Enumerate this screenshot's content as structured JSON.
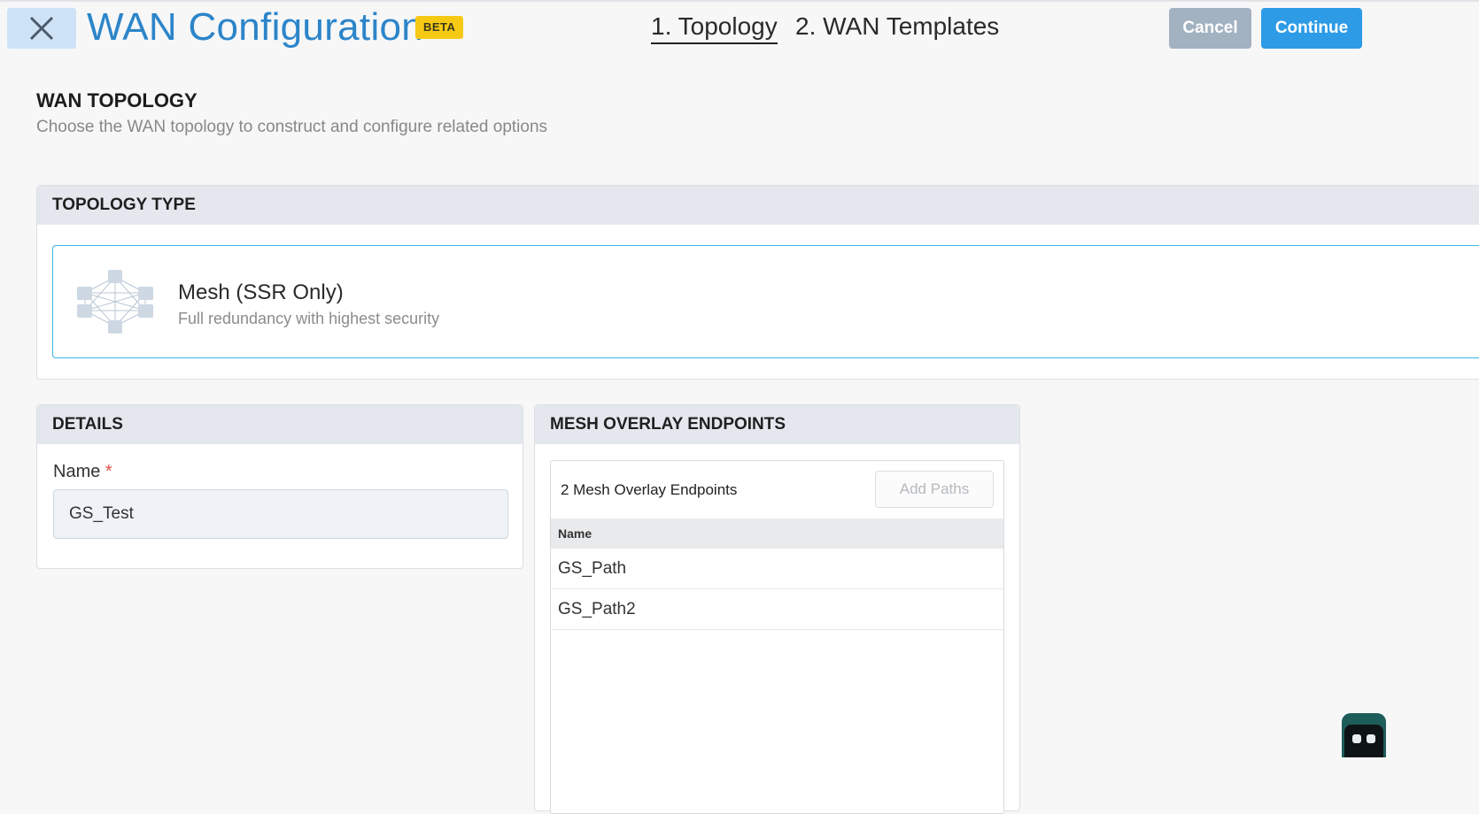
{
  "header": {
    "title": "WAN Configuration",
    "badge": "BETA",
    "steps": [
      {
        "label": "1. Topology",
        "active": true
      },
      {
        "label": "2. WAN Templates",
        "active": false
      }
    ],
    "cancel_label": "Cancel",
    "continue_label": "Continue"
  },
  "section": {
    "title": "WAN TOPOLOGY",
    "subtitle": "Choose the WAN topology to construct and configure related options"
  },
  "topology": {
    "header": "TOPOLOGY TYPE",
    "option": {
      "icon": "mesh-network-icon",
      "title": "Mesh (SSR Only)",
      "subtitle": "Full redundancy with highest security",
      "selected": true
    }
  },
  "details": {
    "header": "DETAILS",
    "name_label": "Name",
    "required_marker": "*",
    "name_value": "GS_Test"
  },
  "mesh": {
    "header": "MESH OVERLAY ENDPOINTS",
    "count_label": "2 Mesh Overlay Endpoints",
    "add_paths_label": "Add Paths",
    "column_name": "Name",
    "rows": [
      "GS_Path",
      "GS_Path2"
    ]
  },
  "colors": {
    "accent": "#2c85c9",
    "continue": "#2d9be6",
    "cancel": "#a3b2c1",
    "badge": "#f6c915",
    "selected_border": "#3bb5e0"
  }
}
